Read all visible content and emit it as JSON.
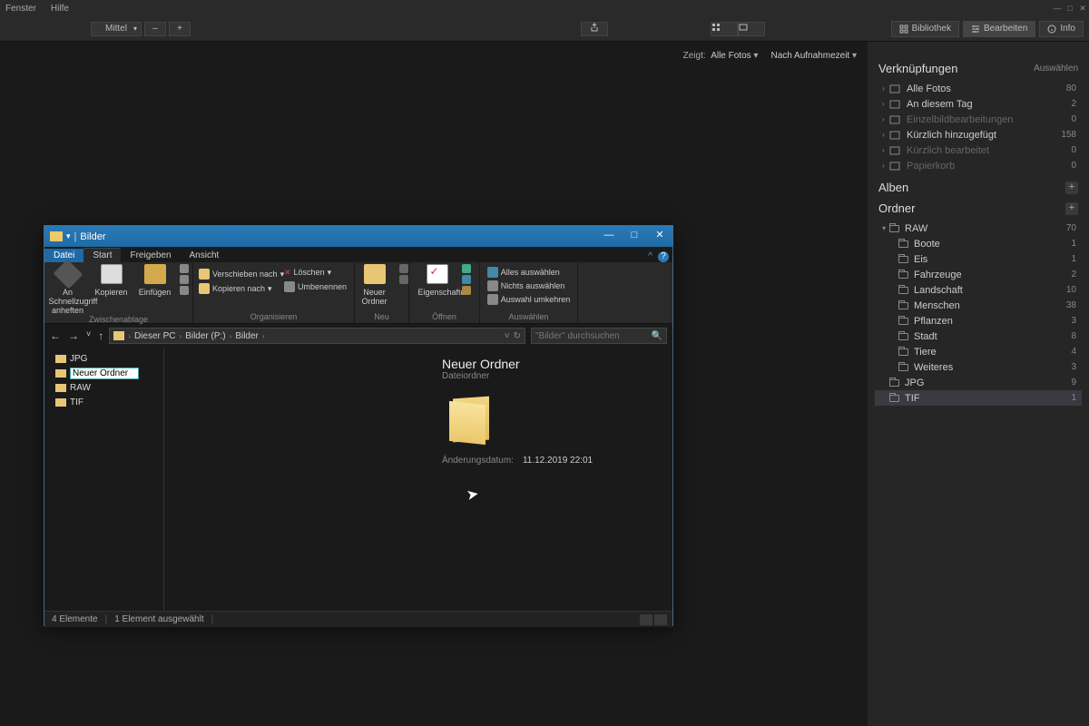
{
  "app": {
    "menu": {
      "window": "Fenster",
      "help": "Hilfe"
    },
    "zoom": {
      "level": "Mittel",
      "minus": "–",
      "plus": "+"
    },
    "modes": {
      "library": "Bibliothek",
      "edit": "Bearbeiten",
      "info": "Info"
    }
  },
  "filters": {
    "shows_label": "Zeigt:",
    "shows_value": "Alle Fotos",
    "sort_value": "Nach Aufnahmezeit"
  },
  "panel": {
    "links": {
      "title": "Verknüpfungen",
      "select": "Auswählen",
      "items": [
        {
          "label": "Alle Fotos",
          "count": "80",
          "dim": false
        },
        {
          "label": "An diesem Tag",
          "count": "2",
          "dim": false
        },
        {
          "label": "Einzelbildbearbeitungen",
          "count": "0",
          "dim": true
        },
        {
          "label": "Kürzlich hinzugefügt",
          "count": "158",
          "dim": false
        },
        {
          "label": "Kürzlich bearbeitet",
          "count": "0",
          "dim": true
        },
        {
          "label": "Papierkorb",
          "count": "0",
          "dim": true
        }
      ]
    },
    "albums": {
      "title": "Alben"
    },
    "folders": {
      "title": "Ordner",
      "root": {
        "label": "RAW",
        "count": "70"
      },
      "children": [
        {
          "label": "Boote",
          "count": "1"
        },
        {
          "label": "Eis",
          "count": "1"
        },
        {
          "label": "Fahrzeuge",
          "count": "2"
        },
        {
          "label": "Landschaft",
          "count": "10"
        },
        {
          "label": "Menschen",
          "count": "38"
        },
        {
          "label": "Pflanzen",
          "count": "3"
        },
        {
          "label": "Stadt",
          "count": "8"
        },
        {
          "label": "Tiere",
          "count": "4"
        },
        {
          "label": "Weiteres",
          "count": "3"
        }
      ],
      "siblings": [
        {
          "label": "JPG",
          "count": "9"
        },
        {
          "label": "TIF",
          "count": "1",
          "selected": true
        }
      ]
    }
  },
  "explorer": {
    "title": "Bilder",
    "tabs": {
      "file": "Datei",
      "start": "Start",
      "share": "Freigeben",
      "view": "Ansicht"
    },
    "ribbon": {
      "clipboard": {
        "pin": "An Schnellzugriff anheften",
        "copy": "Kopieren",
        "paste": "Einfügen",
        "label": "Zwischenablage"
      },
      "organize": {
        "move": "Verschieben nach",
        "copy_to": "Kopieren nach",
        "delete": "Löschen",
        "rename": "Umbenennen",
        "label": "Organisieren"
      },
      "new": {
        "folder": "Neuer Ordner",
        "label": "Neu"
      },
      "open": {
        "props": "Eigenschaften",
        "label": "Öffnen"
      },
      "select": {
        "all": "Alles auswählen",
        "none": "Nichts auswählen",
        "invert": "Auswahl umkehren",
        "label": "Auswählen"
      }
    },
    "breadcrumb": {
      "pc": "Dieser PC",
      "drive": "Bilder (P:)",
      "folder": "Bilder"
    },
    "search_placeholder": "\"Bilder\" durchsuchen",
    "tree": [
      {
        "label": "JPG"
      },
      {
        "label": "Neuer Ordner",
        "editing": true
      },
      {
        "label": "RAW"
      },
      {
        "label": "TIF"
      }
    ],
    "preview": {
      "name": "Neuer Ordner",
      "type": "Dateiordner",
      "mod_label": "Änderungsdatum:",
      "mod_value": "11.12.2019 22:01"
    },
    "status": {
      "count": "4 Elemente",
      "selected": "1 Element ausgewählt"
    }
  }
}
